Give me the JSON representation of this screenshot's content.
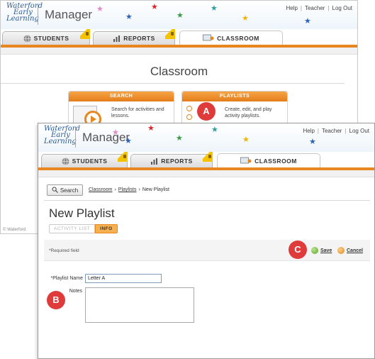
{
  "header": {
    "logo_lines": [
      "Waterford",
      "Early",
      "Learning"
    ],
    "app_title": "Manager",
    "links": [
      "Help",
      "Teacher",
      "Log Out"
    ]
  },
  "tabs": [
    {
      "label": "STUDENTS",
      "icon": "student-globe-icon"
    },
    {
      "label": "REPORTS",
      "icon": "bar-chart-icon"
    },
    {
      "label": "CLASSROOM",
      "icon": "classroom-icon"
    }
  ],
  "back_page": {
    "title": "Classroom",
    "search_card": {
      "heading": "SEARCH",
      "text": "Search for activities and lessons."
    },
    "playlists_card": {
      "heading": "PLAYLISTS",
      "text": "Create, edit, and play activity playlists."
    },
    "copyright": "© Waterford"
  },
  "front_page": {
    "search_button": "Search",
    "breadcrumb": {
      "classroom": "Classroom",
      "playlists": "Playlists",
      "current": "New Playlist",
      "separator": "›"
    },
    "title": "New Playlist",
    "subtabs": {
      "activity_list": "ACTIVITY LIST",
      "info": "INFO"
    },
    "required_note": "*Required field",
    "save_label": "Save",
    "cancel_label": "Cancel",
    "playlist_name_label": "*Playlist Name",
    "playlist_name_value": "Letter A",
    "notes_label": "Notes",
    "notes_value": ""
  },
  "callouts": {
    "a": "A",
    "b": "B",
    "c": "C"
  },
  "colors": {
    "accent_orange": "#e8861f",
    "callout_red": "#e03b3b",
    "logo_blue": "#2a5a92",
    "lock_yellow": "#f6c300"
  }
}
